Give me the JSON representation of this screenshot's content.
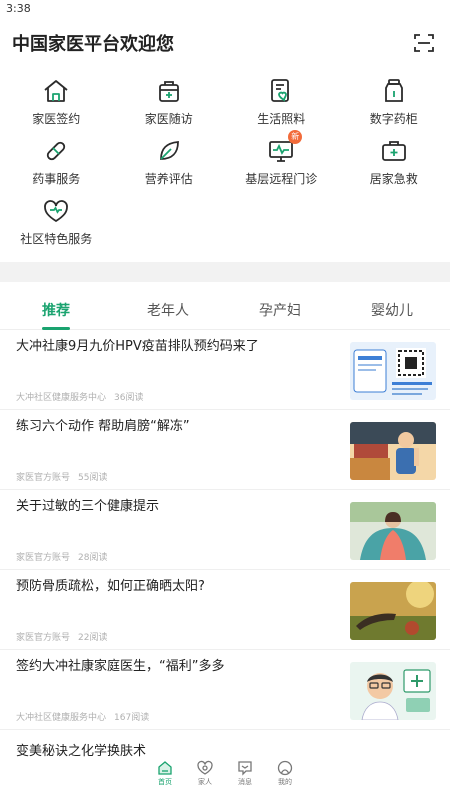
{
  "status_bar": {
    "time": "3:38"
  },
  "header": {
    "title": "中国家医平台欢迎您",
    "scan_icon": "scan-icon"
  },
  "services": [
    {
      "label": "家医签约",
      "icon": "house-icon"
    },
    {
      "label": "家医随访",
      "icon": "medical-kit-icon"
    },
    {
      "label": "生活照料",
      "icon": "document-heart-icon"
    },
    {
      "label": "数字药柜",
      "icon": "medicine-bottle-icon"
    },
    {
      "label": "药事服务",
      "icon": "pill-icon"
    },
    {
      "label": "营养评估",
      "icon": "leaf-icon"
    },
    {
      "label": "基层远程门诊",
      "icon": "monitor-pulse-icon",
      "badge": "新"
    },
    {
      "label": "居家急救",
      "icon": "first-aid-icon"
    },
    {
      "label": "社区特色服务",
      "icon": "heart-shield-icon"
    }
  ],
  "tabs": [
    {
      "label": "推荐",
      "active": true
    },
    {
      "label": "老年人",
      "active": false
    },
    {
      "label": "孕产妇",
      "active": false
    },
    {
      "label": "婴幼儿",
      "active": false
    }
  ],
  "articles": [
    {
      "title": "大冲社康9月九价HPV疫苗排队预约码来了",
      "source": "大冲社区健康服务中心",
      "reads": "36阅读",
      "thumb": "qr-poster"
    },
    {
      "title": "练习六个动作 帮助肩膀“解冻”",
      "source": "家医官方账号",
      "reads": "55阅读",
      "thumb": "shoulder-illustration"
    },
    {
      "title": "关于过敏的三个健康提示",
      "source": "家医官方账号",
      "reads": "28阅读",
      "thumb": "blanket-photo"
    },
    {
      "title": "预防骨质疏松，如何正确晒太阳?",
      "source": "家医官方账号",
      "reads": "22阅读",
      "thumb": "sunlight-photo"
    },
    {
      "title": "签约大冲社康家庭医生，“福利”多多",
      "source": "大冲社区健康服务中心",
      "reads": "167阅读",
      "thumb": "doctor-cartoon"
    }
  ],
  "partial_article": {
    "title": "变美秘诀之化学换肤术"
  },
  "bottom_nav": [
    {
      "label": "首页",
      "icon": "home-icon",
      "active": true
    },
    {
      "label": "家人",
      "icon": "family-heart-icon",
      "active": false
    },
    {
      "label": "消息",
      "icon": "message-icon",
      "active": false
    },
    {
      "label": "我的",
      "icon": "profile-icon",
      "active": false
    }
  ],
  "colors": {
    "accent": "#1aa36f",
    "badge": "#f26b3a",
    "icon_stroke": "#2b2b2b",
    "icon_green": "#1aa36f"
  }
}
